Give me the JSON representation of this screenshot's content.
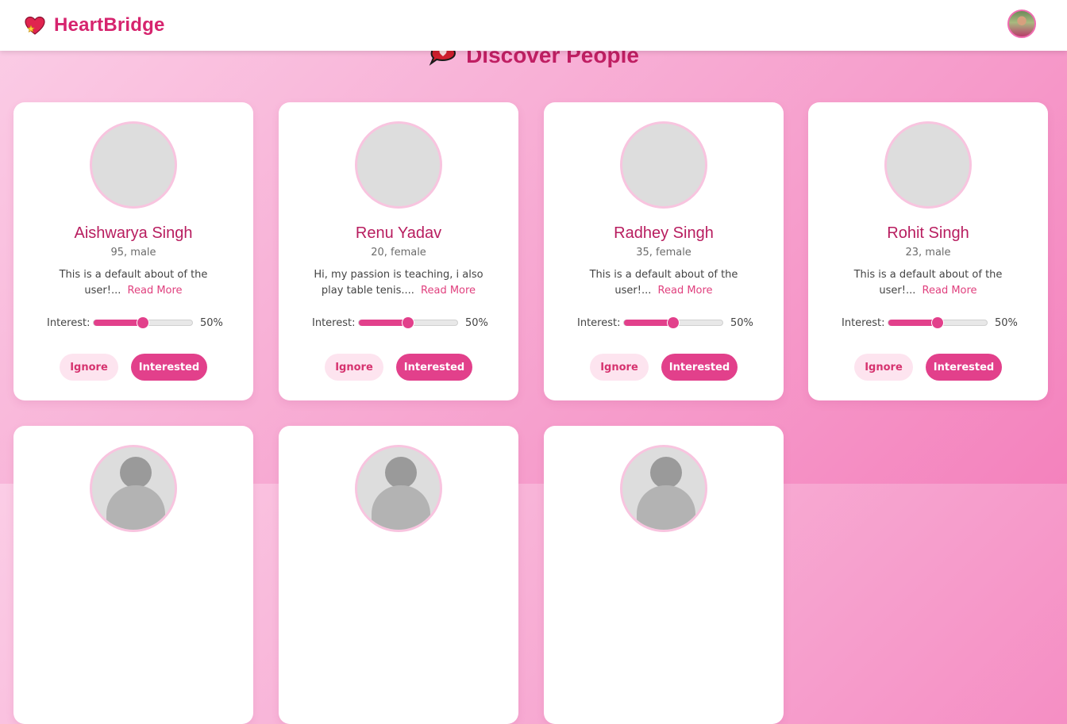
{
  "app": {
    "name": "HeartBridge"
  },
  "page": {
    "title": "Discover People"
  },
  "colors": {
    "brand": "#d6246e",
    "accent": "#e2408b",
    "ignore_bg": "#fde4ef"
  },
  "icons": {
    "brand_logo": "heart-sparkle-icon",
    "title_icon": "speech-heart-icon"
  },
  "cards": [
    {
      "name": "Aishwarya Singh",
      "meta": "95, male",
      "about": "This is a default about of the user!...",
      "read_more": "Read More",
      "interest_label": "Interest:",
      "interest_value": "50%",
      "interest_fraction": 0.5,
      "ignore": "Ignore",
      "interested": "Interested"
    },
    {
      "name": "Renu Yadav",
      "meta": "20, female",
      "about": "Hi, my passion is teaching, i also play table tenis....",
      "read_more": "Read More",
      "interest_label": "Interest:",
      "interest_value": "50%",
      "interest_fraction": 0.5,
      "ignore": "Ignore",
      "interested": "Interested"
    },
    {
      "name": "Radhey Singh",
      "meta": "35, female",
      "about": "This is a default about of the user!...",
      "read_more": "Read More",
      "interest_label": "Interest:",
      "interest_value": "50%",
      "interest_fraction": 0.5,
      "ignore": "Ignore",
      "interested": "Interested"
    },
    {
      "name": "Rohit Singh",
      "meta": "23, male",
      "about": "This is a default about of the user!...",
      "read_more": "Read More",
      "interest_label": "Interest:",
      "interest_value": "50%",
      "interest_fraction": 0.5,
      "ignore": "Ignore",
      "interested": "Interested"
    }
  ],
  "more_cards_count_visible": 3
}
